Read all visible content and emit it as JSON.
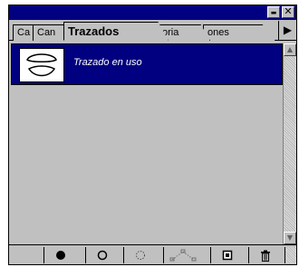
{
  "window": {
    "minimize_glyph": "▬",
    "close_glyph": "✕"
  },
  "tabs": [
    {
      "label": "Ca",
      "active": false
    },
    {
      "label": "Can",
      "active": false
    },
    {
      "label": "Trazados",
      "active": true
    },
    {
      "label": "oria",
      "active": false
    },
    {
      "label": "ones",
      "active": false
    }
  ],
  "tab_scroll_glyph": "▶",
  "paths": [
    {
      "label": "Trazado en uso",
      "selected": true,
      "icon": "path-thumbnail-icon"
    }
  ],
  "scrollbar": {
    "up_glyph": "▲",
    "down_glyph": "▼"
  },
  "toolbar": {
    "buttons": [
      {
        "name": "fill-path-button",
        "icon": "filled-circle-icon"
      },
      {
        "name": "stroke-path-button",
        "icon": "hollow-circle-icon"
      },
      {
        "name": "load-selection-button",
        "icon": "dotted-circle-icon"
      },
      {
        "name": "make-work-path-button",
        "icon": "selection-to-path-icon"
      },
      {
        "name": "new-path-button",
        "icon": "new-page-icon"
      },
      {
        "name": "delete-path-button",
        "icon": "trash-icon"
      }
    ]
  },
  "colors": {
    "titlebar": "#000080",
    "selection": "#000080",
    "panel": "#c0c0c0"
  }
}
